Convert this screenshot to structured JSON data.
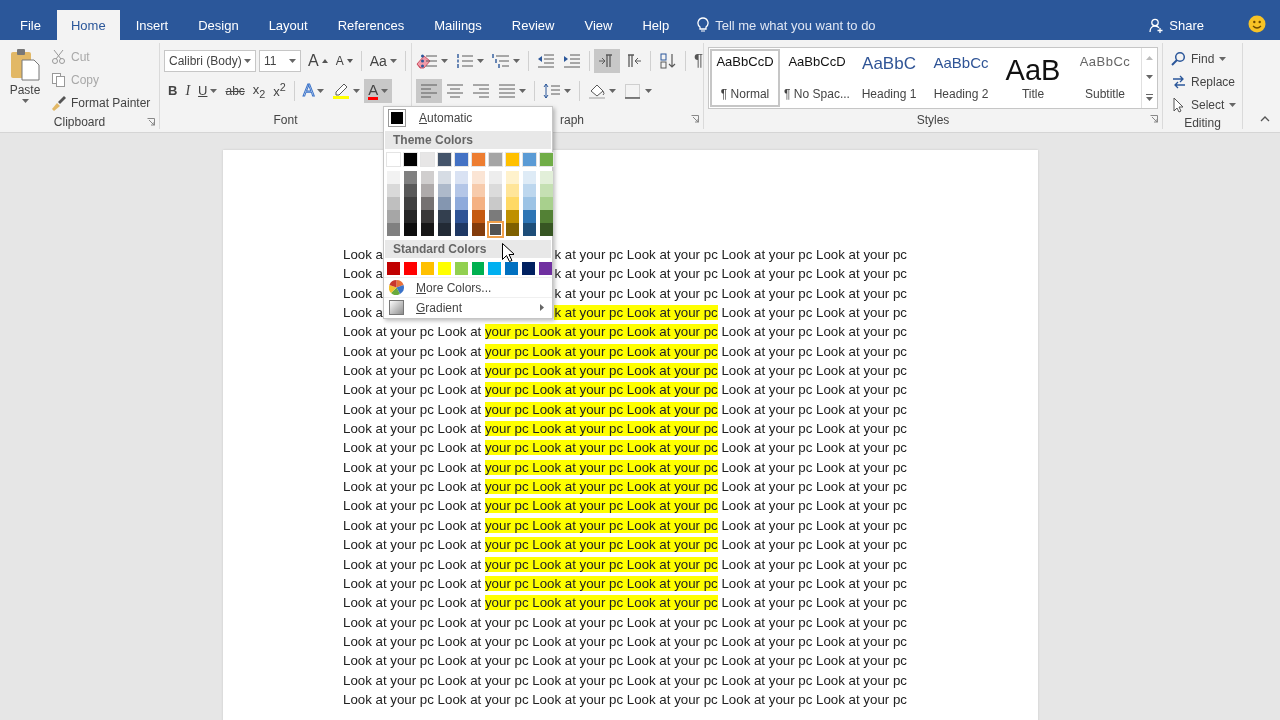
{
  "tabs": [
    {
      "label": "File",
      "selected": false
    },
    {
      "label": "Home",
      "selected": true
    },
    {
      "label": "Insert",
      "selected": false
    },
    {
      "label": "Design",
      "selected": false
    },
    {
      "label": "Layout",
      "selected": false
    },
    {
      "label": "References",
      "selected": false
    },
    {
      "label": "Mailings",
      "selected": false
    },
    {
      "label": "Review",
      "selected": false
    },
    {
      "label": "View",
      "selected": false
    },
    {
      "label": "Help",
      "selected": false
    }
  ],
  "tell_me": {
    "placeholder": "Tell me what you want to do"
  },
  "share": "Share",
  "clipboard": {
    "label": "Clipboard",
    "paste": "Paste",
    "items": [
      {
        "kind": "cut",
        "label": "Cut",
        "disabled": true
      },
      {
        "kind": "copy",
        "label": "Copy",
        "disabled": true
      },
      {
        "kind": "painter",
        "label": "Format Painter",
        "disabled": false
      }
    ]
  },
  "font": {
    "label": "Font",
    "name": "Calibri (Body)",
    "size": "11",
    "row1": [
      {
        "kind": "grow",
        "label": "A"
      },
      {
        "kind": "shrink",
        "label": "A"
      },
      {
        "kind": "separator"
      },
      {
        "kind": "case",
        "label": "Aa"
      },
      {
        "kind": "separator"
      },
      {
        "kind": "clear"
      }
    ],
    "row2": [
      {
        "kind": "bold",
        "label": "B"
      },
      {
        "kind": "italic",
        "label": "I"
      },
      {
        "kind": "underline",
        "label": "U"
      },
      {
        "kind": "strike",
        "label": "abc"
      },
      {
        "kind": "subscript",
        "label": "x$_{2}$"
      },
      {
        "kind": "superscript",
        "label": "x$^{2}$"
      },
      {
        "kind": "separator"
      },
      {
        "kind": "effects",
        "label": "A"
      },
      {
        "kind": "highlight"
      },
      {
        "kind": "color",
        "label": "A",
        "expanded": true
      }
    ]
  },
  "paragraph": {
    "label": "raph",
    "row1": [
      {
        "kind": "bullets"
      },
      {
        "kind": "numbering"
      },
      {
        "kind": "multilevel"
      },
      {
        "kind": "separator"
      },
      {
        "kind": "outdent"
      },
      {
        "kind": "indent"
      },
      {
        "kind": "separator"
      },
      {
        "kind": "ltr",
        "selected": true
      },
      {
        "kind": "rtl",
        "selected": false
      },
      {
        "kind": "separator"
      },
      {
        "kind": "sort"
      },
      {
        "kind": "separator"
      },
      {
        "kind": "marks",
        "label": "¶"
      }
    ],
    "row2": [
      {
        "kind": "align-left",
        "selected": true
      },
      {
        "kind": "center",
        "selected": false
      },
      {
        "kind": "align-right",
        "selected": false
      },
      {
        "kind": "justify",
        "selected": false
      },
      {
        "kind": "separator"
      },
      {
        "kind": "spacing"
      },
      {
        "kind": "separator"
      },
      {
        "kind": "shading"
      },
      {
        "kind": "borders"
      }
    ]
  },
  "styles": {
    "label": "Styles",
    "items": [
      {
        "kind": "normal",
        "preview": "AaBbCcD",
        "name": "¶ Normal",
        "selected": true
      },
      {
        "kind": "normal",
        "preview": "AaBbCcD",
        "name": "¶ No Spac...",
        "selected": false
      },
      {
        "kind": "heading1",
        "preview": "AaBbC",
        "name": "Heading 1",
        "selected": false
      },
      {
        "kind": "heading2",
        "preview": "AaBbCc",
        "name": "Heading 2",
        "selected": false
      },
      {
        "kind": "title",
        "preview": "AaB",
        "name": "Title",
        "selected": false
      },
      {
        "kind": "subtitle",
        "preview": "AaBbCc",
        "name": "Subtitle",
        "selected": false
      }
    ]
  },
  "editing": {
    "label": "Editing",
    "items": [
      {
        "kind": "find",
        "label": "Find"
      },
      {
        "kind": "replace",
        "label": "Replace"
      },
      {
        "kind": "select",
        "label": "Select"
      }
    ]
  },
  "font_color_menu": {
    "automatic": "Automatic",
    "theme_header": "Theme Colors",
    "theme_colors": [
      {
        "swatches": [
          {
            "color": "#ffffff",
            "selected": false
          },
          {
            "color": "#f2f2f2",
            "selected": false
          },
          {
            "color": "#d9d9d9",
            "selected": false
          },
          {
            "color": "#bfbfbf",
            "selected": false
          },
          {
            "color": "#a6a6a6",
            "selected": false
          },
          {
            "color": "#808080",
            "selected": false
          }
        ]
      },
      {
        "swatches": [
          {
            "color": "#000000",
            "selected": false
          },
          {
            "color": "#808080",
            "selected": false
          },
          {
            "color": "#595959",
            "selected": false
          },
          {
            "color": "#404040",
            "selected": false
          },
          {
            "color": "#262626",
            "selected": false
          },
          {
            "color": "#0d0d0d",
            "selected": false
          }
        ]
      },
      {
        "swatches": [
          {
            "color": "#e7e6e6",
            "selected": false
          },
          {
            "color": "#d0cece",
            "selected": false
          },
          {
            "color": "#aeaaaa",
            "selected": false
          },
          {
            "color": "#757171",
            "selected": false
          },
          {
            "color": "#3a3838",
            "selected": false
          },
          {
            "color": "#171616",
            "selected": false
          }
        ]
      },
      {
        "swatches": [
          {
            "color": "#44546a",
            "selected": false
          },
          {
            "color": "#d6dce4",
            "selected": false
          },
          {
            "color": "#adb9ca",
            "selected": false
          },
          {
            "color": "#8496b0",
            "selected": false
          },
          {
            "color": "#333f4f",
            "selected": false
          },
          {
            "color": "#222a35",
            "selected": false
          }
        ]
      },
      {
        "swatches": [
          {
            "color": "#4472c4",
            "selected": false
          },
          {
            "color": "#d9e2f3",
            "selected": false
          },
          {
            "color": "#b4c6e7",
            "selected": false
          },
          {
            "color": "#8eaadb",
            "selected": false
          },
          {
            "color": "#2f5496",
            "selected": false
          },
          {
            "color": "#1f3864",
            "selected": false
          }
        ]
      },
      {
        "swatches": [
          {
            "color": "#ed7d31",
            "selected": false
          },
          {
            "color": "#fbe5d5",
            "selected": false
          },
          {
            "color": "#f7cbac",
            "selected": false
          },
          {
            "color": "#f4b183",
            "selected": false
          },
          {
            "color": "#c55a11",
            "selected": false
          },
          {
            "color": "#843c0b",
            "selected": false
          }
        ]
      },
      {
        "swatches": [
          {
            "color": "#a5a5a5",
            "selected": false
          },
          {
            "color": "#ededed",
            "selected": false
          },
          {
            "color": "#dbdbdb",
            "selected": false
          },
          {
            "color": "#c9c9c9",
            "selected": false
          },
          {
            "color": "#7b7b7b",
            "selected": false
          },
          {
            "color": "#525252",
            "selected": true
          }
        ]
      },
      {
        "swatches": [
          {
            "color": "#ffc000",
            "selected": false
          },
          {
            "color": "#fff2cc",
            "selected": false
          },
          {
            "color": "#ffe599",
            "selected": false
          },
          {
            "color": "#ffd965",
            "selected": false
          },
          {
            "color": "#bf9000",
            "selected": false
          },
          {
            "color": "#7f6000",
            "selected": false
          }
        ]
      },
      {
        "swatches": [
          {
            "color": "#5b9bd5",
            "selected": false
          },
          {
            "color": "#deebf6",
            "selected": false
          },
          {
            "color": "#bdd7ee",
            "selected": false
          },
          {
            "color": "#9cc3e5",
            "selected": false
          },
          {
            "color": "#2e75b5",
            "selected": false
          },
          {
            "color": "#1e4e79",
            "selected": false
          }
        ]
      },
      {
        "swatches": [
          {
            "color": "#70ad47",
            "selected": false
          },
          {
            "color": "#e2efd9",
            "selected": false
          },
          {
            "color": "#c5e0b3",
            "selected": false
          },
          {
            "color": "#a8d08d",
            "selected": false
          },
          {
            "color": "#538135",
            "selected": false
          },
          {
            "color": "#375623",
            "selected": false
          }
        ]
      }
    ],
    "standard_header": "Standard Colors",
    "standard_colors": [
      {
        "color": "#c00000",
        "selected": false
      },
      {
        "color": "#ff0000",
        "selected": false
      },
      {
        "color": "#ffc000",
        "selected": false
      },
      {
        "color": "#ffff00",
        "selected": false
      },
      {
        "color": "#92d050",
        "selected": false
      },
      {
        "color": "#00b050",
        "selected": false
      },
      {
        "color": "#00b0f0",
        "selected": false
      },
      {
        "color": "#0070c0",
        "selected": false
      },
      {
        "color": "#002060",
        "selected": false
      },
      {
        "color": "#7030a0",
        "selected": false
      }
    ],
    "more": "More Colors...",
    "gradient": "Gradient"
  },
  "document": {
    "lines": [
      {
        "kind": "split",
        "left": [
          {
            "text": "Look a",
            "highlight": false
          }
        ],
        "right": [
          {
            "text": "k at your pc Look at your pc Look at your pc Look at your pc",
            "highlight": false
          }
        ]
      },
      {
        "kind": "split",
        "left": [
          {
            "text": "Look a",
            "highlight": false
          }
        ],
        "right": [
          {
            "text": "k at your pc Look at your pc Look at your pc Look at your pc",
            "highlight": false
          }
        ]
      },
      {
        "kind": "split",
        "left": [
          {
            "text": "Look a",
            "highlight": false
          }
        ],
        "right": [
          {
            "text": "k at your pc Look at your pc Look at your pc Look at your pc",
            "highlight": false
          }
        ]
      },
      {
        "kind": "split",
        "left": [
          {
            "text": "Look a",
            "highlight": false
          }
        ],
        "right": [
          {
            "text": "k at your pc Look at your pc",
            "highlight": true
          },
          {
            "text": " Look at your pc Look at your pc",
            "highlight": false
          }
        ]
      },
      {
        "kind": "full",
        "segments": [
          {
            "text": "Look at your pc Look at ",
            "highlight": false
          },
          {
            "text": "your pc Look at your pc Look at your pc",
            "highlight": true
          },
          {
            "text": " Look at your pc Look at your pc",
            "highlight": false
          }
        ]
      },
      {
        "kind": "full",
        "segments": [
          {
            "text": "Look at your pc Look at ",
            "highlight": false
          },
          {
            "text": "your pc Look at your pc Look at your pc",
            "highlight": true
          },
          {
            "text": " Look at your pc Look at your pc",
            "highlight": false
          }
        ]
      },
      {
        "kind": "full",
        "segments": [
          {
            "text": "Look at your pc Look at ",
            "highlight": false
          },
          {
            "text": "your pc Look at your pc Look at your pc",
            "highlight": true
          },
          {
            "text": " Look at your pc Look at your pc",
            "highlight": false
          }
        ]
      },
      {
        "kind": "full",
        "segments": [
          {
            "text": "Look at your pc Look at ",
            "highlight": false
          },
          {
            "text": "your pc Look at your pc Look at your pc",
            "highlight": true
          },
          {
            "text": " Look at your pc Look at your pc",
            "highlight": false
          }
        ]
      },
      {
        "kind": "full",
        "segments": [
          {
            "text": "Look at your pc Look at ",
            "highlight": false
          },
          {
            "text": "your pc Look at your pc Look at your pc",
            "highlight": true
          },
          {
            "text": " Look at your pc Look at your pc",
            "highlight": false
          }
        ]
      },
      {
        "kind": "full",
        "segments": [
          {
            "text": "Look at your pc Look at ",
            "highlight": false
          },
          {
            "text": "your pc Look at your pc Look at your pc",
            "highlight": true
          },
          {
            "text": " Look at your pc Look at your pc",
            "highlight": false
          }
        ]
      },
      {
        "kind": "full",
        "segments": [
          {
            "text": "Look at your pc Look at ",
            "highlight": false
          },
          {
            "text": "your pc Look at your pc Look at your pc",
            "highlight": true
          },
          {
            "text": " Look at your pc Look at your pc",
            "highlight": false
          }
        ]
      },
      {
        "kind": "full",
        "segments": [
          {
            "text": "Look at your pc Look at ",
            "highlight": false
          },
          {
            "text": "your pc Look at your pc Look at your pc",
            "highlight": true
          },
          {
            "text": " Look at your pc Look at your pc",
            "highlight": false
          }
        ]
      },
      {
        "kind": "full",
        "segments": [
          {
            "text": "Look at your pc Look at ",
            "highlight": false
          },
          {
            "text": "your pc Look at your pc Look at your pc",
            "highlight": true
          },
          {
            "text": " Look at your pc Look at your pc",
            "highlight": false
          }
        ]
      },
      {
        "kind": "full",
        "segments": [
          {
            "text": "Look at your pc Look at ",
            "highlight": false
          },
          {
            "text": "your pc Look at your pc Look at your pc",
            "highlight": true
          },
          {
            "text": " Look at your pc Look at your pc",
            "highlight": false
          }
        ]
      },
      {
        "kind": "full",
        "segments": [
          {
            "text": "Look at your pc Look at ",
            "highlight": false
          },
          {
            "text": "your pc Look at your pc Look at your pc",
            "highlight": true
          },
          {
            "text": " Look at your pc Look at your pc",
            "highlight": false
          }
        ]
      },
      {
        "kind": "full",
        "segments": [
          {
            "text": "Look at your pc Look at ",
            "highlight": false
          },
          {
            "text": "your pc Look at your pc Look at your pc",
            "highlight": true
          },
          {
            "text": " Look at your pc Look at your pc",
            "highlight": false
          }
        ]
      },
      {
        "kind": "full",
        "segments": [
          {
            "text": "Look at your pc Look at ",
            "highlight": false
          },
          {
            "text": "your pc Look at your pc Look at your pc",
            "highlight": true
          },
          {
            "text": " Look at your pc Look at your pc",
            "highlight": false
          }
        ]
      },
      {
        "kind": "full",
        "segments": [
          {
            "text": "Look at your pc Look at ",
            "highlight": false
          },
          {
            "text": "your pc Look at your pc Look at your pc",
            "highlight": true
          },
          {
            "text": " Look at your pc Look at your pc",
            "highlight": false
          }
        ]
      },
      {
        "kind": "full",
        "segments": [
          {
            "text": "Look at your pc Look at ",
            "highlight": false
          },
          {
            "text": "your pc Look at your pc Look at your pc",
            "highlight": true
          },
          {
            "text": " Look at your pc Look at your pc",
            "highlight": false
          }
        ]
      },
      {
        "kind": "full",
        "segments": [
          {
            "text": "Look at your pc Look at your pc Look at your pc Look at your pc Look at your pc Look at your pc",
            "highlight": false
          }
        ]
      },
      {
        "kind": "full",
        "segments": [
          {
            "text": "Look at your pc Look at your pc Look at your pc Look at your pc Look at your pc Look at your pc",
            "highlight": false
          }
        ]
      },
      {
        "kind": "full",
        "segments": [
          {
            "text": "Look at your pc Look at your pc Look at your pc Look at your pc Look at your pc Look at your pc",
            "highlight": false
          }
        ]
      },
      {
        "kind": "full",
        "segments": [
          {
            "text": "Look at your pc Look at your pc Look at your pc Look at your pc Look at your pc Look at your pc",
            "highlight": false
          }
        ]
      },
      {
        "kind": "full",
        "segments": [
          {
            "text": "Look at your pc Look at your pc Look at your pc Look at your pc Look at your pc Look at your pc",
            "highlight": false
          }
        ]
      }
    ]
  }
}
